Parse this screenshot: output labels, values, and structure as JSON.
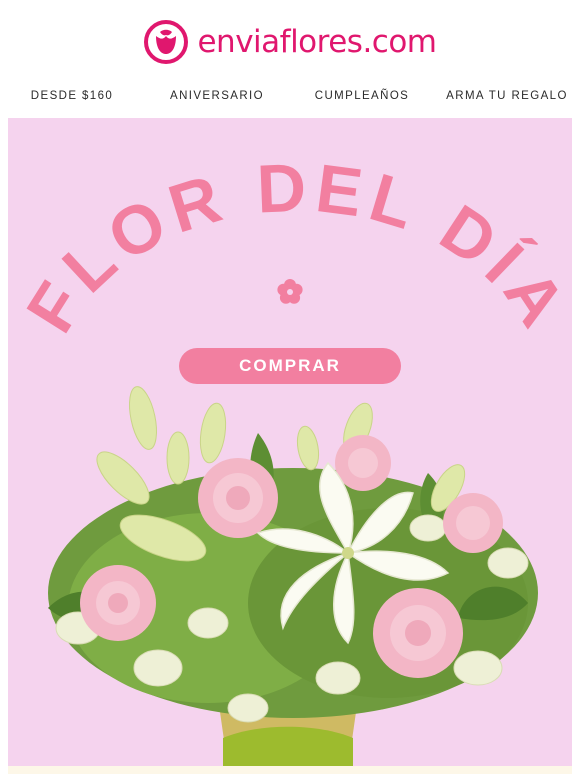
{
  "brand": {
    "name": "enviaflores.com",
    "color": "#e0176e"
  },
  "nav": {
    "items": [
      {
        "label": "DESDE $160"
      },
      {
        "label": "ANIVERSARIO"
      },
      {
        "label": "CUMPLEAÑOS"
      },
      {
        "label": "ARMA TU REGALO"
      }
    ]
  },
  "hero": {
    "headline": "FLOR DEL DÍA",
    "cta_label": "COMPRAR",
    "background": "#f5d3ee",
    "accent": "#f27fa0",
    "image_alt": "bouquet-photo"
  }
}
